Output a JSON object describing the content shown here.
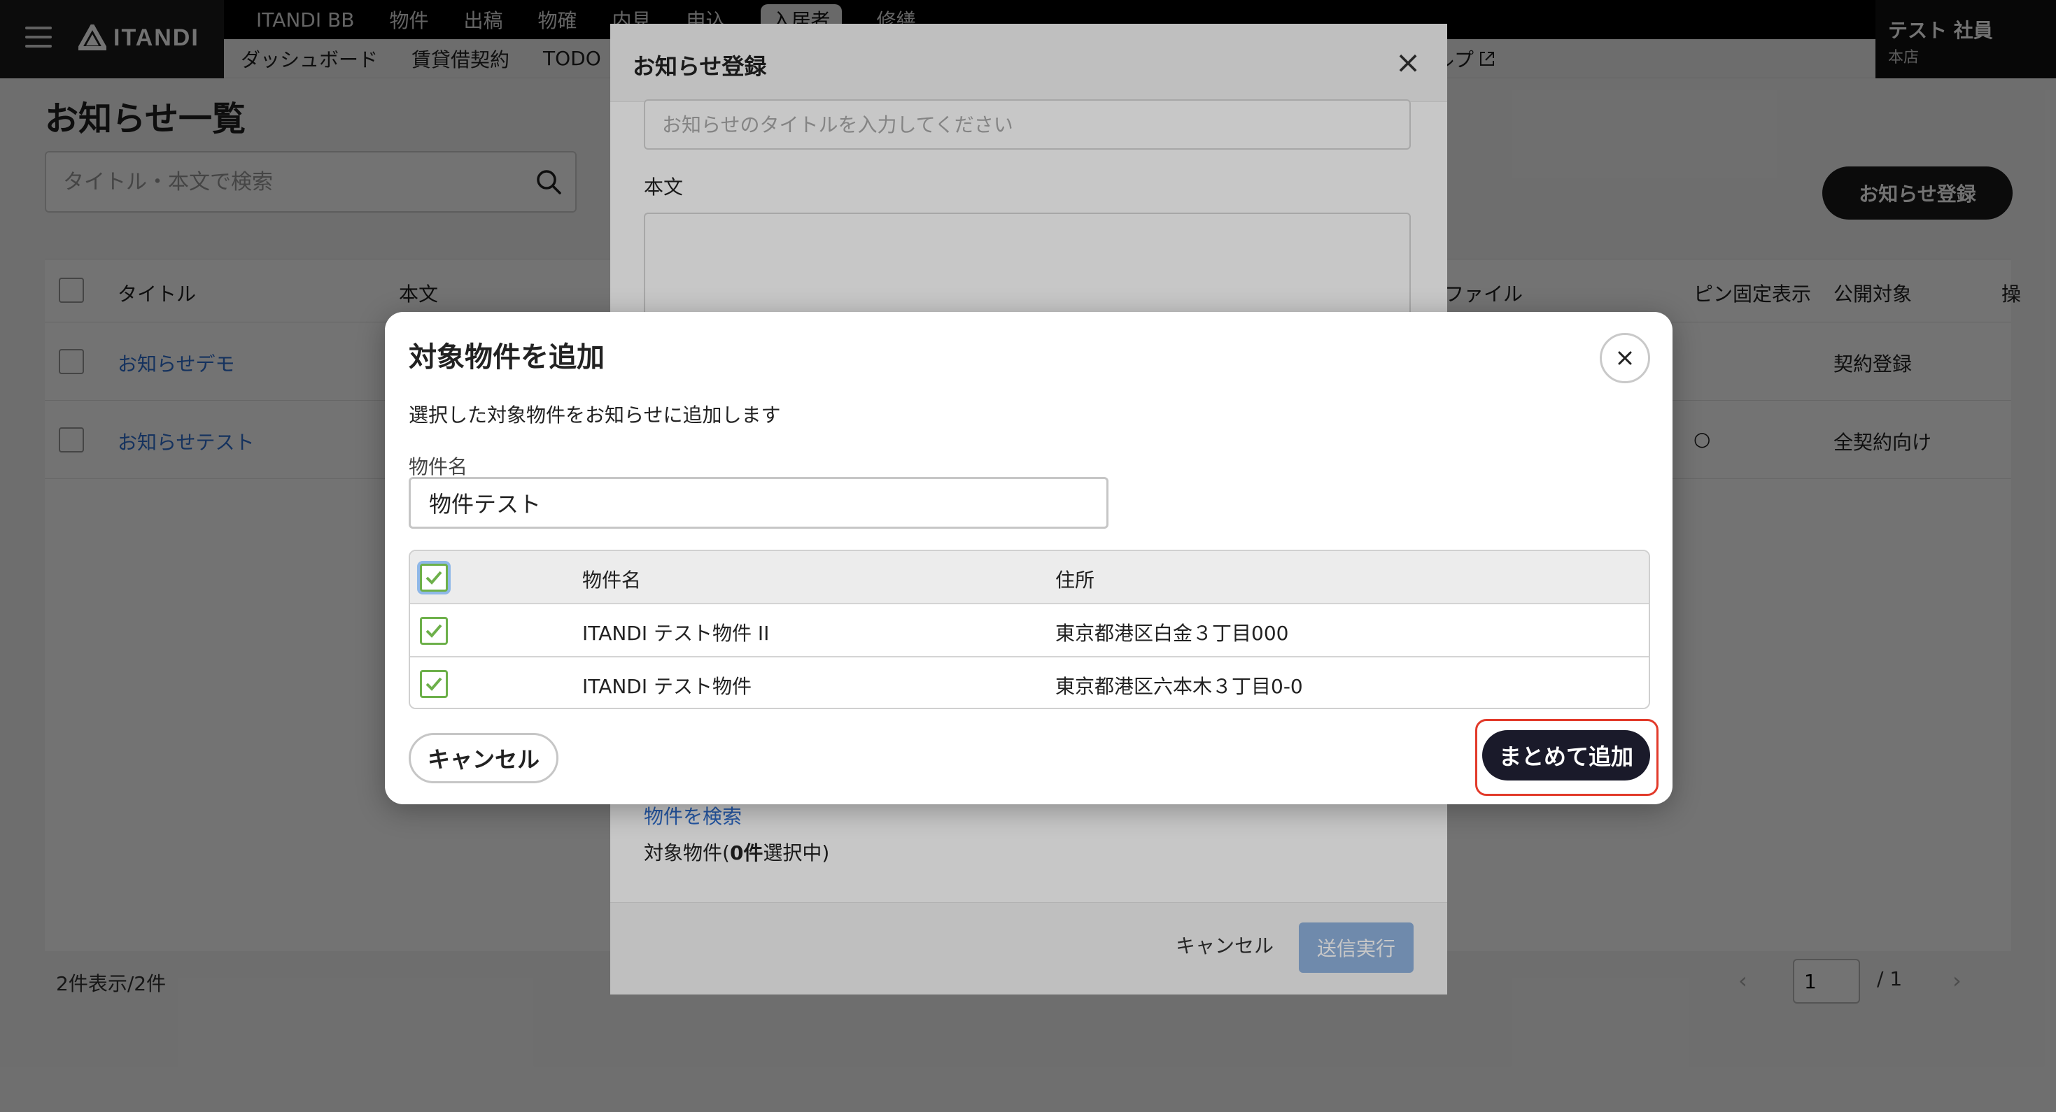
{
  "app": {
    "logo_text": "ITANDI"
  },
  "nav": {
    "row1": [
      "ITANDI BB",
      "物件",
      "出稿",
      "物確",
      "内見",
      "申込",
      "入居者",
      "修繕"
    ],
    "row2": [
      "ダッシュボード",
      "賃貸借契約",
      "TODO"
    ],
    "help": "ルプ"
  },
  "user": {
    "name": "テスト 社員",
    "branch": "本店"
  },
  "page": {
    "title": "お知らせ一覧",
    "search_placeholder": "タイトル・本文で検索",
    "register_button": "お知らせ登録"
  },
  "table": {
    "headers": {
      "title": "タイトル",
      "body": "本文",
      "file": "ファイル",
      "pin": "ピン固定表示",
      "target": "公開対象",
      "extra": "操"
    },
    "rows": [
      {
        "title": "お知らせデモ",
        "pin": "",
        "target": "契約登録"
      },
      {
        "title": "お知らせテスト",
        "pin": "○",
        "target": "全契約向け"
      }
    ],
    "count_text": "2件表示/2件",
    "pager": {
      "prev": "‹",
      "page": "1",
      "total": "/ 1",
      "next": "›"
    }
  },
  "notice_modal": {
    "title": "お知らせ登録",
    "title_placeholder": "お知らせのタイトルを入力してください",
    "body_label": "本文",
    "search_link": "物件を検索",
    "selected_prefix": "対象物件(",
    "selected_count": "0件",
    "selected_suffix": "選択中)",
    "cancel": "キャンセル",
    "submit": "送信実行"
  },
  "add_modal": {
    "title": "対象物件を追加",
    "description": "選択した対象物件をお知らせに追加します",
    "name_label": "物件名",
    "name_value": "物件テスト",
    "columns": {
      "name": "物件名",
      "address": "住所"
    },
    "rows": [
      {
        "name": "ITANDI テスト物件 II",
        "address": "東京都港区白金３丁目000",
        "checked": true
      },
      {
        "name": "ITANDI テスト物件",
        "address": "東京都港区六本木３丁目0-0",
        "checked": true
      }
    ],
    "select_all_checked": true,
    "cancel": "キャンセル",
    "add_all": "まとめて追加"
  },
  "colors": {
    "accent_link": "#2f6fd0",
    "checkbox_green": "#6db04a",
    "highlight_red": "#e23a2a",
    "primary_dark": "#1a1a2a"
  }
}
